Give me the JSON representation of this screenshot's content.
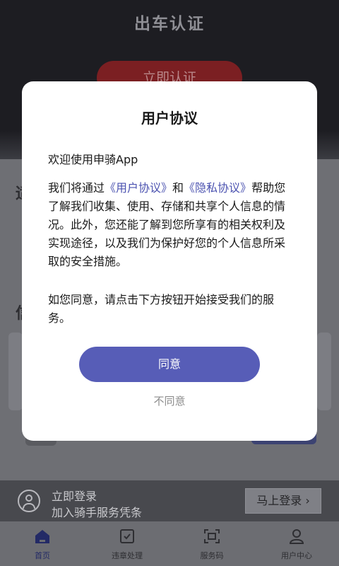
{
  "hero": {
    "title": "出车认证",
    "button": "立即认证"
  },
  "background": {
    "left_fragment_1": "适",
    "left_fragment_2": "信"
  },
  "login_bar": {
    "title": "立即登录",
    "subtitle": "加入骑手服务凭条",
    "button": "马上登录",
    "button_arrow": "›"
  },
  "tabs": [
    {
      "label": "首页",
      "icon": "home-icon",
      "active": true
    },
    {
      "label": "违章处理",
      "icon": "violation-icon",
      "active": false
    },
    {
      "label": "服务码",
      "icon": "scan-code-icon",
      "active": false
    },
    {
      "label": "用户中心",
      "icon": "user-icon",
      "active": false
    }
  ],
  "modal": {
    "title": "用户协议",
    "welcome": "欢迎使用申骑App",
    "p1_a": "我们将通过",
    "p1_link1": "《用户协议》",
    "p1_and": "和",
    "p1_link2": "《隐私协议》",
    "p1_b": "帮助您了解我们收集、使用、存储和共享个人信息的情况。此外，您还能了解到您所享有的相关权利及实现途径，以及我们为保护好您的个人信息所采取的安全措施。",
    "p2": "如您同意，请点击下方按钮开始接受我们的服务。",
    "agree": "同意",
    "disagree": "不同意"
  },
  "colors": {
    "accent": "#575db7",
    "link": "#4b52b0",
    "hero_button": "#7b1f22"
  }
}
